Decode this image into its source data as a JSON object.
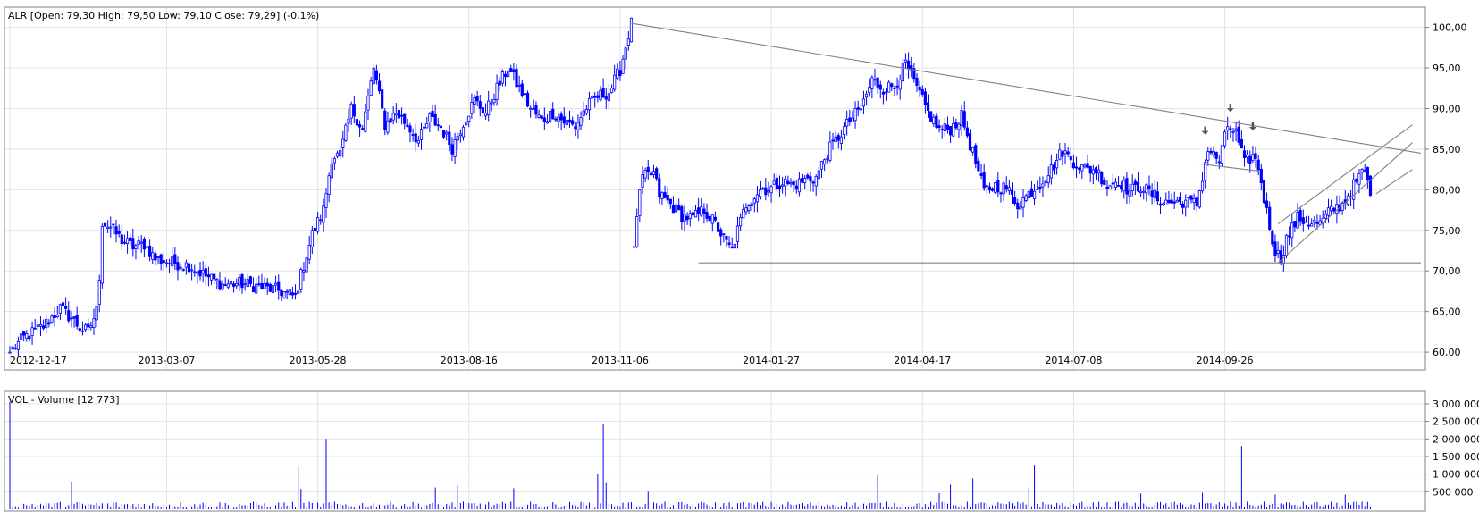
{
  "price_panel": {
    "legend": "ALR [Open: 79,30  High: 79,50  Low: 79,10  Close: 79,29] (-0,1%)"
  },
  "volume_panel": {
    "legend": "VOL - Volume [12 773]"
  },
  "colors": {
    "candle": "#0000ff",
    "grid": "#e3e3e3",
    "frame": "#808080",
    "trendline": "#808080",
    "marker": "#555555",
    "text": "#000000"
  },
  "chart_data": [
    {
      "type": "candlestick",
      "name": "ALR",
      "x_tick_labels": [
        "2012-12-17",
        "2013-03-07",
        "2013-05-28",
        "2013-08-16",
        "2013-11-06",
        "2014-01-27",
        "2014-04-17",
        "2014-07-08",
        "2014-09-26"
      ],
      "y_tick_labels": [
        "60,00",
        "65,00",
        "70,00",
        "75,00",
        "80,00",
        "85,00",
        "90,00",
        "95,00",
        "100,00"
      ],
      "y_ticks": [
        60,
        65,
        70,
        75,
        80,
        85,
        90,
        95,
        100
      ],
      "ylim": [
        58.8,
        101.5
      ],
      "grid": true,
      "close_path": [
        [
          0,
          60
        ],
        [
          5,
          61.8
        ],
        [
          12,
          63.2
        ],
        [
          18,
          65.4
        ],
        [
          22,
          64.2
        ],
        [
          25,
          63
        ],
        [
          28,
          62.5
        ],
        [
          31,
          65.1
        ],
        [
          32,
          69.4
        ],
        [
          33,
          76
        ],
        [
          36,
          75.4
        ],
        [
          40,
          73.8
        ],
        [
          44,
          73
        ],
        [
          48,
          73.3
        ],
        [
          52,
          71.5
        ],
        [
          58,
          71
        ],
        [
          64,
          70.7
        ],
        [
          70,
          69.4
        ],
        [
          76,
          68.3
        ],
        [
          82,
          68.5
        ],
        [
          90,
          68
        ],
        [
          96,
          67.6
        ],
        [
          102,
          66.8
        ],
        [
          104,
          69.5
        ],
        [
          108,
          74.5
        ],
        [
          112,
          77.5
        ],
        [
          115,
          84
        ],
        [
          118,
          84.3
        ],
        [
          122,
          90
        ],
        [
          126,
          87.5
        ],
        [
          130,
          95
        ],
        [
          134,
          88
        ],
        [
          138,
          89.5
        ],
        [
          142,
          88
        ],
        [
          146,
          86
        ],
        [
          150,
          88.8
        ],
        [
          154,
          87.7
        ],
        [
          158,
          85.2
        ],
        [
          162,
          88.3
        ],
        [
          166,
          91
        ],
        [
          170,
          89.5
        ],
        [
          174,
          92.5
        ],
        [
          178,
          95
        ],
        [
          182,
          92.5
        ],
        [
          186,
          90
        ],
        [
          190,
          88.5
        ],
        [
          194,
          89.5
        ],
        [
          198,
          88.4
        ],
        [
          202,
          87.8
        ],
        [
          206,
          90.2
        ],
        [
          210,
          91.5
        ],
        [
          214,
          92
        ],
        [
          218,
          94.8
        ],
        [
          222,
          100.5
        ],
        [
          223,
          73
        ],
        [
          224,
          77
        ],
        [
          226,
          81.5
        ],
        [
          230,
          82
        ],
        [
          232,
          79.5
        ],
        [
          236,
          78.2
        ],
        [
          240,
          76.8
        ],
        [
          244,
          76.5
        ],
        [
          248,
          77.5
        ],
        [
          252,
          75.8
        ],
        [
          256,
          73.4
        ],
        [
          258,
          72.5
        ],
        [
          260,
          75
        ],
        [
          263,
          78.2
        ],
        [
          268,
          80
        ],
        [
          272,
          80.2
        ],
        [
          276,
          81
        ],
        [
          280,
          80.5
        ],
        [
          284,
          81.2
        ],
        [
          288,
          81.5
        ],
        [
          292,
          84.6
        ],
        [
          296,
          86.5
        ],
        [
          300,
          88.5
        ],
        [
          304,
          90
        ],
        [
          308,
          93.5
        ],
        [
          312,
          92.5
        ],
        [
          316,
          92.8
        ],
        [
          320,
          95.5
        ],
        [
          324,
          92.5
        ],
        [
          328,
          89.5
        ],
        [
          332,
          87.4
        ],
        [
          336,
          87.5
        ],
        [
          340,
          89
        ],
        [
          344,
          84.5
        ],
        [
          348,
          79.8
        ],
        [
          352,
          80.5
        ],
        [
          356,
          80.2
        ],
        [
          360,
          78.2
        ],
        [
          364,
          79.5
        ],
        [
          368,
          80.8
        ],
        [
          372,
          82.5
        ],
        [
          376,
          84.8
        ],
        [
          380,
          83.5
        ],
        [
          384,
          82.5
        ],
        [
          388,
          82.5
        ],
        [
          392,
          80.5
        ],
        [
          396,
          81.2
        ],
        [
          400,
          79.8
        ],
        [
          404,
          80.5
        ],
        [
          408,
          79.4
        ],
        [
          412,
          78.5
        ],
        [
          416,
          78.4
        ],
        [
          420,
          78.6
        ],
        [
          424,
          78.2
        ],
        [
          428,
          85
        ],
        [
          432,
          83.5
        ],
        [
          435,
          87.8
        ],
        [
          438,
          87
        ],
        [
          441,
          83.2
        ],
        [
          444,
          84.2
        ],
        [
          446,
          82.8
        ],
        [
          448,
          79
        ],
        [
          450,
          75.5
        ],
        [
          452,
          72.5
        ],
        [
          454,
          71.5
        ],
        [
          456,
          74
        ],
        [
          460,
          76.5
        ],
        [
          464,
          76
        ],
        [
          468,
          75.8
        ],
        [
          472,
          77.5
        ],
        [
          476,
          78.2
        ],
        [
          480,
          80.5
        ],
        [
          484,
          82.5
        ],
        [
          486,
          79.3
        ]
      ],
      "annotations": [
        {
          "type": "trendline",
          "from": [
            222,
            100.5
          ],
          "to": [
            504,
            84.5
          ]
        },
        {
          "type": "trendline",
          "from": [
            246,
            71
          ],
          "to": [
            504,
            71
          ]
        },
        {
          "type": "trendline",
          "from": [
            425,
            83.2
          ],
          "to": [
            446,
            82.3
          ]
        },
        {
          "type": "trendline",
          "from": [
            453,
            71
          ],
          "to": [
            501,
            85.8
          ]
        },
        {
          "type": "trendline",
          "from": [
            453,
            75.8
          ],
          "to": [
            501,
            88
          ]
        },
        {
          "type": "trendline",
          "from": [
            488,
            79.5
          ],
          "to": [
            501,
            82.5
          ]
        },
        {
          "type": "marker",
          "shape": "down-arrow",
          "x": 427,
          "y": 86.8
        },
        {
          "type": "marker",
          "shape": "down-arrow",
          "x": 436,
          "y": 89.6
        },
        {
          "type": "marker",
          "shape": "down-arrow",
          "x": 444,
          "y": 87.3
        }
      ]
    },
    {
      "type": "bar",
      "name": "VOL - Volume",
      "y_tick_labels": [
        "500 000",
        "1 000 000",
        "1 500 000",
        "2 000 000",
        "2 500 000",
        "3 000 000"
      ],
      "y_ticks": [
        500000,
        1000000,
        1500000,
        2000000,
        2500000,
        3000000
      ],
      "ylim": [
        0,
        3100000
      ],
      "grid": true,
      "spikes": [
        [
          0,
          3050000
        ],
        [
          22,
          780000
        ],
        [
          103,
          1220000
        ],
        [
          104,
          580000
        ],
        [
          113,
          2000000
        ],
        [
          152,
          620000
        ],
        [
          160,
          680000
        ],
        [
          180,
          600000
        ],
        [
          210,
          1000000
        ],
        [
          212,
          2420000
        ],
        [
          213,
          750000
        ],
        [
          228,
          500000
        ],
        [
          310,
          960000
        ],
        [
          332,
          460000
        ],
        [
          336,
          700000
        ],
        [
          344,
          880000
        ],
        [
          366,
          1240000
        ],
        [
          364,
          600000
        ],
        [
          404,
          450000
        ],
        [
          426,
          470000
        ],
        [
          440,
          1800000
        ],
        [
          452,
          420000
        ],
        [
          477,
          420000
        ]
      ]
    }
  ]
}
